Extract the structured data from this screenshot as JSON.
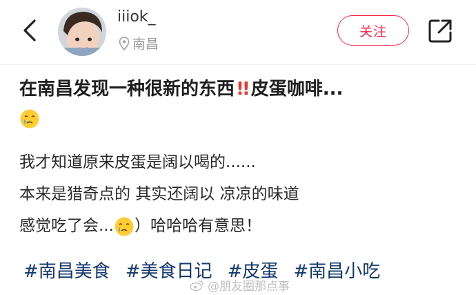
{
  "header": {
    "username": "iiiok_",
    "location": "南昌",
    "follow_label": "关注"
  },
  "post": {
    "title_part1": "在南昌发现一种很新的东西",
    "title_bang": "!!",
    "title_part2": "皮蛋咖啡...",
    "line1": "我才知道原来皮蛋是阔以喝的......",
    "line2": "本来是猎奇点的 其实还阔以 凉凉的味道",
    "line3_a": "感觉吃了会...",
    "line3_b": "）哈哈哈有意思！",
    "tags": [
      "#南昌美食",
      "#美食日记",
      "#皮蛋",
      "#南昌小吃"
    ]
  },
  "watermark": "@朋友圈那点事",
  "colors": {
    "accent": "#ff2442",
    "tag": "#13386c",
    "bang": "#e53935"
  }
}
